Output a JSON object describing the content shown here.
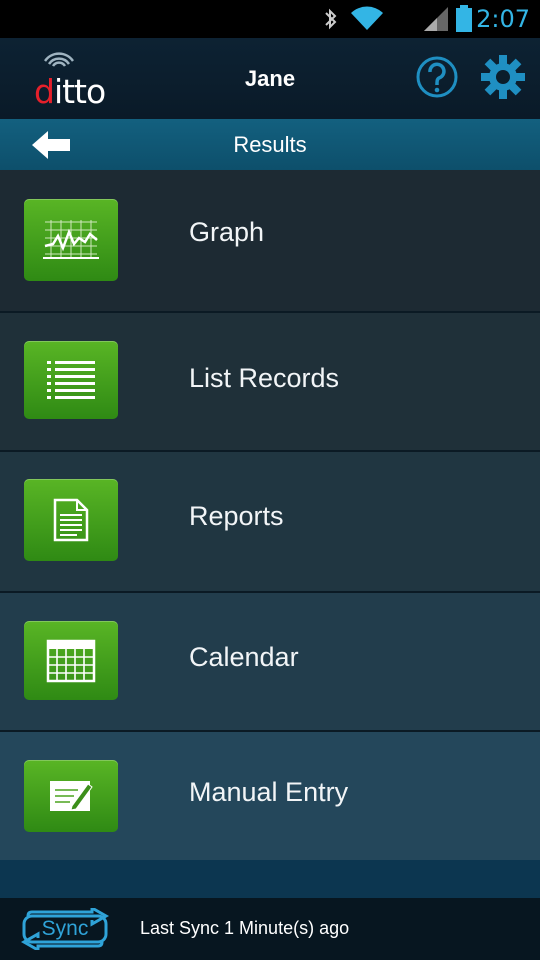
{
  "status_bar": {
    "time": "2:07",
    "icons": [
      "bluetooth-icon",
      "wifi-icon",
      "cell-signal-icon",
      "battery-icon"
    ]
  },
  "header": {
    "logo_text": "ditto",
    "user_name": "Jane",
    "help_icon": "help-icon",
    "settings_icon": "gear-icon"
  },
  "title_bar": {
    "title": "Results",
    "back_icon": "back-arrow-icon"
  },
  "menu": {
    "items": [
      {
        "label": "Graph",
        "icon": "graph-icon"
      },
      {
        "label": "List Records",
        "icon": "list-icon"
      },
      {
        "label": "Reports",
        "icon": "document-icon"
      },
      {
        "label": "Calendar",
        "icon": "calendar-icon"
      },
      {
        "label": "Manual Entry",
        "icon": "edit-icon"
      }
    ]
  },
  "footer": {
    "sync_label": "Sync",
    "sync_status": "Last Sync 1 Minute(s) ago"
  },
  "colors": {
    "accent": "#33b5e5",
    "tile_green": "#4aa31e",
    "logo_red": "#e4202b"
  }
}
